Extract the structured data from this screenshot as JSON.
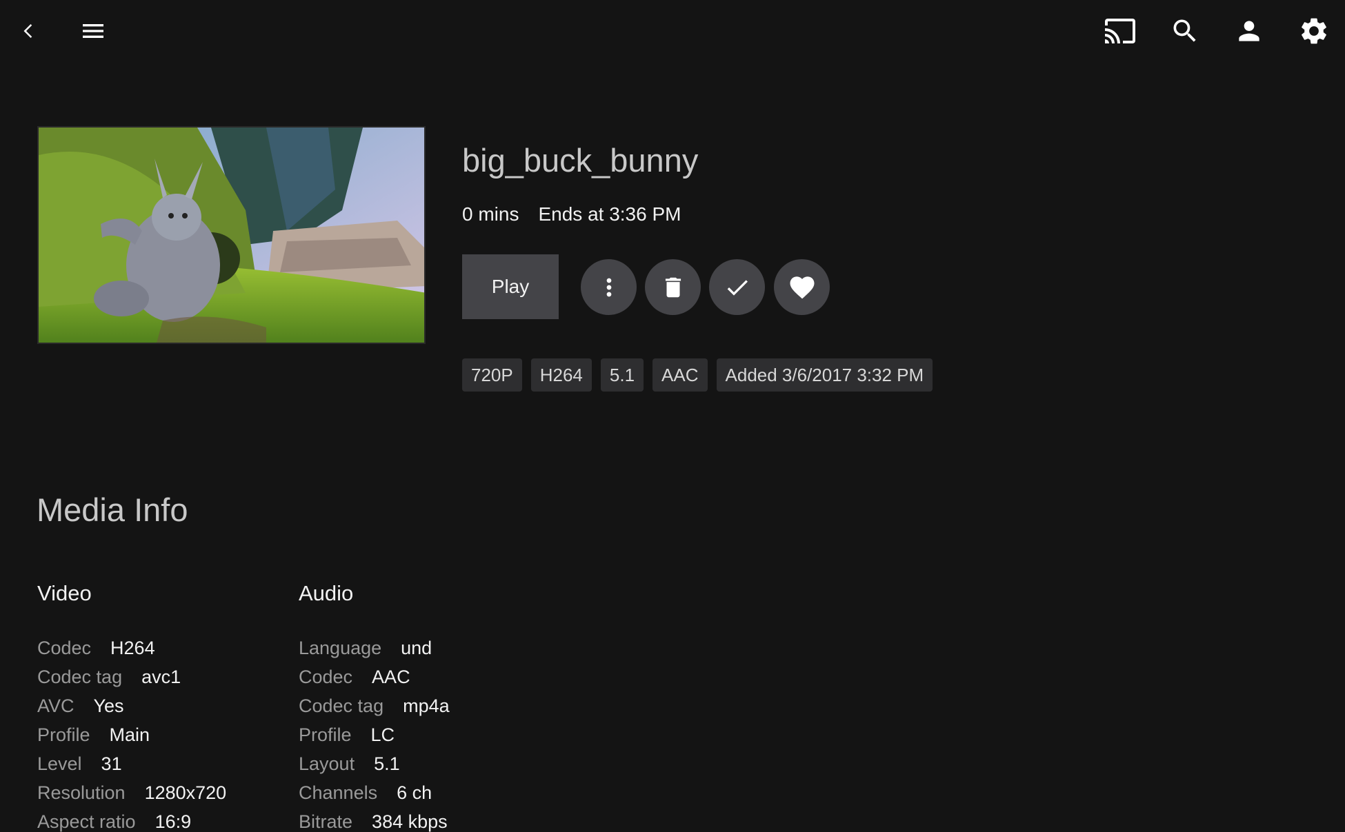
{
  "topbar": {
    "left_icons": [
      "back-icon",
      "menu-icon"
    ],
    "right_icons": [
      "cast-icon",
      "search-icon",
      "user-icon",
      "settings-icon"
    ]
  },
  "item": {
    "title": "big_buck_bunny",
    "duration": "0 mins",
    "ends_at": "Ends at 3:36 PM",
    "play_label": "Play",
    "action_icons": [
      "more-vert-icon",
      "delete-icon",
      "check-icon",
      "heart-icon"
    ],
    "tags": [
      "720P",
      "H264",
      "5.1",
      "AAC",
      "Added 3/6/2017 3:32 PM"
    ]
  },
  "media_info": {
    "title": "Media Info",
    "video": {
      "heading": "Video",
      "rows": [
        {
          "label": "Codec",
          "value": "H264"
        },
        {
          "label": "Codec tag",
          "value": "avc1"
        },
        {
          "label": "AVC",
          "value": "Yes"
        },
        {
          "label": "Profile",
          "value": "Main"
        },
        {
          "label": "Level",
          "value": "31"
        },
        {
          "label": "Resolution",
          "value": "1280x720"
        },
        {
          "label": "Aspect ratio",
          "value": "16:9"
        }
      ]
    },
    "audio": {
      "heading": "Audio",
      "rows": [
        {
          "label": "Language",
          "value": "und"
        },
        {
          "label": "Codec",
          "value": "AAC"
        },
        {
          "label": "Codec tag",
          "value": "mp4a"
        },
        {
          "label": "Profile",
          "value": "LC"
        },
        {
          "label": "Layout",
          "value": "5.1"
        },
        {
          "label": "Channels",
          "value": "6 ch"
        },
        {
          "label": "Bitrate",
          "value": "384 kbps"
        }
      ]
    }
  },
  "colors": {
    "background": "#141414",
    "button": "#444448",
    "tag": "#2e2e30",
    "title": "#c8c8c8",
    "label": "#9a9a9a"
  }
}
